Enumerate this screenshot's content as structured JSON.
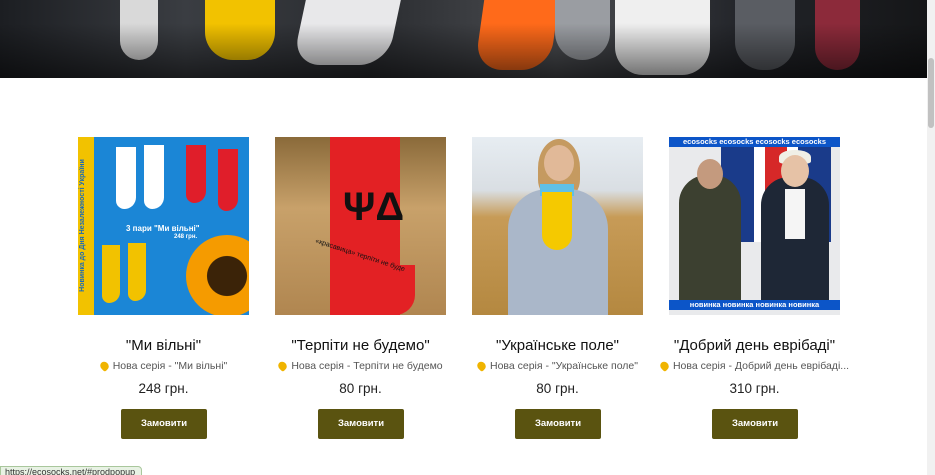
{
  "products": [
    {
      "title": "\"Ми вільні\"",
      "subtitle": "Нова серія - \"Ми вільні\"",
      "price": "248 грн.",
      "button_label": "Замовити",
      "image_text": {
        "vertical": "Новинка до Дня Незалежності України",
        "line1": "3 пари \"Ми вільні\"",
        "line2": "248 грн."
      }
    },
    {
      "title": "\"Терпіти не будемо\"",
      "subtitle": "Нова серія - Терпіти не будемо",
      "price": "80 грн.",
      "button_label": "Замовити",
      "image_text": {
        "mark": "ΨΔ",
        "caption": "«красавица» терпіти не буде"
      }
    },
    {
      "title": "\"Українське поле\"",
      "subtitle": "Нова серія - \"Українське поле\"",
      "price": "80 грн.",
      "button_label": "Замовити"
    },
    {
      "title": "\"Добрий день еврібаді\"",
      "subtitle": "Нова серія - Добрий день еврібаді...",
      "price": "310 грн.",
      "button_label": "Замовити",
      "image_text": {
        "top_banner": "ecosocks  ecosocks  ecosocks  ecosocks",
        "bottom_banner": "новинка  новинка  новинка  новинка"
      }
    }
  ],
  "status_bar": {
    "url": "https://ecosocks.net/#prodpopup"
  },
  "colors": {
    "button_bg": "#5a5310",
    "button_text": "#ffffff",
    "heart": "#f0b400"
  }
}
